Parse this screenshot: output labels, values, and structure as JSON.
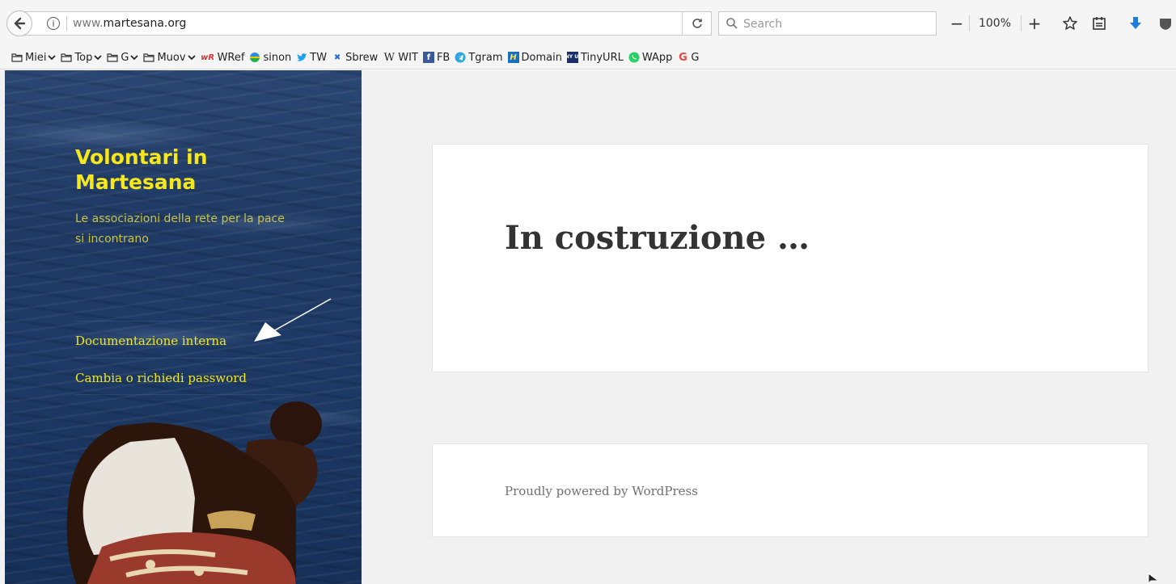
{
  "browser": {
    "url_prefix": "www.",
    "url_host": "martesana.org",
    "search_placeholder": "Search",
    "zoom_out": "−",
    "zoom_level": "100%",
    "zoom_in": "+",
    "icons": {
      "back": "back-arrow-icon",
      "info": "info-icon",
      "reload": "reload-icon",
      "search": "search-icon",
      "bookmark": "star-icon",
      "reader": "reader-view-icon",
      "download": "download-icon"
    }
  },
  "bookmarks": [
    {
      "label": "Miei",
      "icon": "folder-icon",
      "folder": true
    },
    {
      "label": "Top",
      "icon": "folder-icon",
      "folder": true
    },
    {
      "label": "G",
      "icon": "folder-icon",
      "folder": true
    },
    {
      "label": "Muov",
      "icon": "folder-icon",
      "folder": true
    },
    {
      "label": "WRef",
      "icon": "wordreference-icon",
      "folder": false
    },
    {
      "label": "sinon",
      "icon": "sinon-icon",
      "folder": false
    },
    {
      "label": "TW",
      "icon": "twitter-icon",
      "folder": false
    },
    {
      "label": "Sbrew",
      "icon": "sbrew-icon",
      "folder": false
    },
    {
      "label": "WIT",
      "icon": "wikipedia-icon",
      "folder": false
    },
    {
      "label": "FB",
      "icon": "facebook-icon",
      "folder": false
    },
    {
      "label": "Tgram",
      "icon": "telegram-icon",
      "folder": false
    },
    {
      "label": "Domain",
      "icon": "domain-icon",
      "folder": false
    },
    {
      "label": "TinyURL",
      "icon": "tinyurl-icon",
      "folder": false
    },
    {
      "label": "WApp",
      "icon": "whatsapp-icon",
      "folder": false
    },
    {
      "label": "G",
      "icon": "google-icon",
      "folder": false
    }
  ],
  "site": {
    "title": "Volontari in Martesana",
    "description": "Le associazioni della rete per la pace si incontrano",
    "menu": [
      {
        "label": "Documentazione interna"
      },
      {
        "label": "Cambia o richiedi password"
      }
    ]
  },
  "post": {
    "title": "In costruzione …"
  },
  "footer": {
    "text": "Proudly powered by WordPress"
  },
  "colors": {
    "title_yellow": "#f5e71b",
    "sidebar_blue": "#1f3a64",
    "page_bg": "#f1f1f1"
  }
}
